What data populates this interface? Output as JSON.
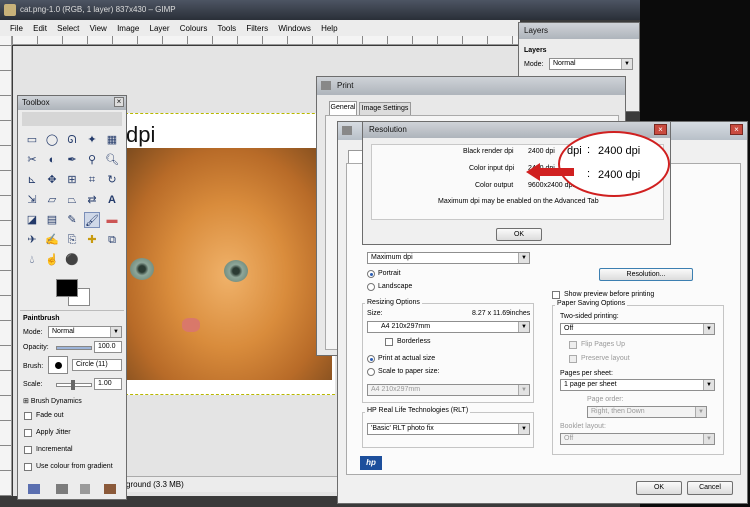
{
  "gimp": {
    "title": "cat.png-1.0 (RGB, 1 layer) 837x430 – GIMP",
    "menu": [
      "File",
      "Edit",
      "Select",
      "View",
      "Image",
      "Layer",
      "Colours",
      "Tools",
      "Filters",
      "Windows",
      "Help"
    ],
    "canvas_text": "dpi",
    "status": "ground (3.3 MB)"
  },
  "layers": {
    "title": "Layers",
    "header": "Layers",
    "mode_label": "Mode:",
    "mode_value": "Normal"
  },
  "toolbox": {
    "title": "Toolbox",
    "tool_icons": [
      "rect-select",
      "ellipse-select",
      "free-select",
      "fuzzy-select",
      "colour-select",
      "scissors",
      "foreground-select",
      "paths",
      "colour-picker",
      "zoom",
      "measure",
      "move",
      "align",
      "crop",
      "rotate",
      "scale",
      "shear",
      "perspective",
      "flip",
      "text",
      "bucket-fill",
      "blend",
      "pencil",
      "paintbrush",
      "eraser",
      "airbrush",
      "ink",
      "clone",
      "heal",
      "perspective-clone",
      "blur",
      "smudge",
      "dodge-burn"
    ],
    "options_title": "Paintbrush",
    "mode_label": "Mode:",
    "mode_value": "Normal",
    "opacity_label": "Opacity:",
    "opacity_value": "100.0",
    "brush_label": "Brush:",
    "brush_value": "Circle (11)",
    "scale_label": "Scale:",
    "scale_value": "1.00",
    "options": [
      "Brush Dynamics",
      "Fade out",
      "Apply Jitter",
      "Incremental",
      "Use colour from gradient"
    ]
  },
  "print": {
    "title": "Print",
    "tabs": [
      "General",
      "Image Settings"
    ]
  },
  "resolution": {
    "title": "Resolution",
    "rows": [
      {
        "label": "Black render dpi",
        "value": "2400 dpi"
      },
      {
        "label": "Color input dpi",
        "value": "2400 dpi"
      },
      {
        "label": "Color output",
        "value": "9600x2400 dpi"
      }
    ],
    "note": "Maximum dpi may be enabled on the Advanced Tab",
    "ok": "OK",
    "callout": {
      "dpi": "dpi",
      "value1": "2400 dpi",
      "value2": "2400 dpi"
    }
  },
  "props": {
    "print_quality_value": "Maximum dpi",
    "portrait": "Portrait",
    "landscape": "Landscape",
    "resizing_title": "Resizing Options",
    "size_label": "Size:",
    "size_value": "8.27 x 11.69inches",
    "paper_value": "A4 210x297mm",
    "borderless": "Borderless",
    "actual_size": "Print at actual size",
    "scale_paper": "Scale to paper size:",
    "scale_paper_value": "A4 210x297mm",
    "rlt_title": "HP Real Life Technologies (RLT)",
    "rlt_value": "'Basic' RLT photo fix",
    "resolution_btn": "Resolution...",
    "show_preview": "Show preview before printing",
    "paper_saving_title": "Paper Saving Options",
    "two_sided_label": "Two-sided printing:",
    "two_sided_value": "Off",
    "flip_pages": "Flip Pages Up",
    "preserve_layout": "Preserve layout",
    "pages_per_sheet_label": "Pages per sheet:",
    "pages_per_sheet_value": "1 page per sheet",
    "page_order_label": "Page order:",
    "page_order_value": "Right, then Down",
    "booklet_label": "Booklet layout:",
    "booklet_value": "Off",
    "ok": "OK",
    "cancel": "Cancel",
    "logo": "hp"
  },
  "colors": {
    "accent": "#2d5fb5",
    "callout": "#d02020"
  }
}
